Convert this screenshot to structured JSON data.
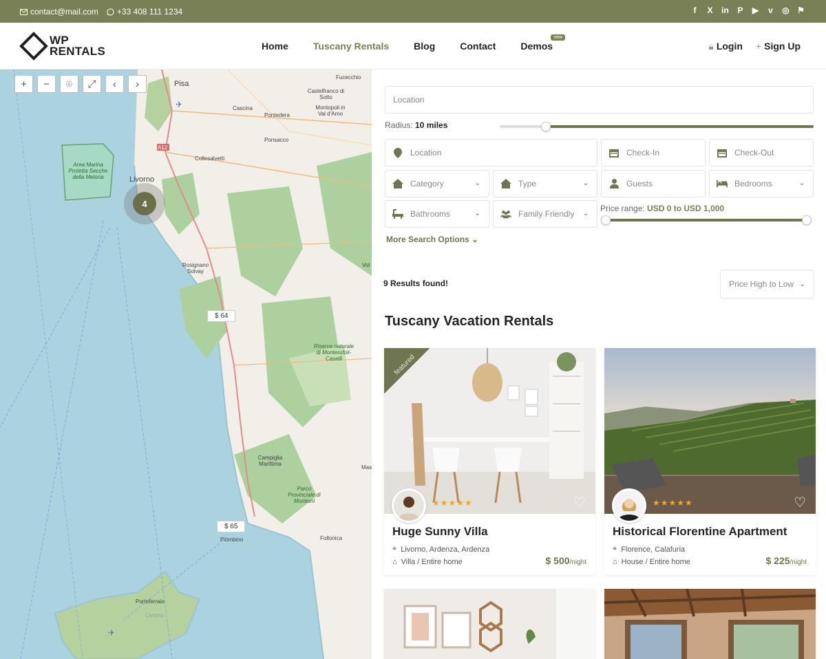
{
  "topbar": {
    "email": "contact@mail.com",
    "phone": "+33 408 111 1234",
    "social": [
      "facebook-icon",
      "x-icon",
      "linkedin-icon",
      "pinterest-icon",
      "youtube-icon",
      "vimeo-icon",
      "instagram-icon",
      "foursquare-icon"
    ]
  },
  "header": {
    "logo_line1": "WP",
    "logo_line2": "RENTALS",
    "nav": [
      "Home",
      "Tuscany Rentals",
      "Blog",
      "Contact",
      "Demos"
    ],
    "demos_badge": "new",
    "login": "Login",
    "signup": "Sign Up"
  },
  "map": {
    "cluster_count": "4",
    "price_pins": [
      "$ 64",
      "$ 65"
    ],
    "labels": {
      "pisa": "Pisa",
      "livorno": "Livorno",
      "cascina": "Cascina",
      "pontedera": "Pontedera",
      "collesalvetti": "Collesalvetti",
      "ponsacco": "Ponsacco",
      "rosignano": "Rosignano Solvay",
      "campiglia": "Campiglia Marittima",
      "piombino": "Piombino",
      "follonica": "Follonica",
      "portoferraio": "Portoferraio",
      "fucecchio": "Fucecchio",
      "castelfranco": "Castelfranco di Sotto",
      "montopoli": "Montopoli in Val d'Arno",
      "area_marina": "Area Marina Protetta Secche della Meloria",
      "riserva": "Riserva naturale di Monterufoli-Caselli",
      "parco": "Parco Provinciale di Montioni",
      "road_a12": "A12",
      "livorno_small": "Livorno",
      "mas": "Mas",
      "vol": "Vol"
    }
  },
  "search": {
    "location_placeholder": "Location",
    "radius_label": "Radius:",
    "radius_value": "10 miles",
    "location2_placeholder": "Location",
    "checkin": "Check-In",
    "checkout": "Check-Out",
    "category": "Category",
    "type": "Type",
    "guests": "Guests",
    "bedrooms": "Bedrooms",
    "bathrooms": "Bathrooms",
    "family": "Family Friendly",
    "price_label": "Price range:",
    "price_value": "USD 0 to USD 1,000",
    "more": "More Search Options"
  },
  "results": {
    "count_text": "9 Results found!",
    "sort": "Price High to Low",
    "section_title": "Tuscany Vacation Rentals"
  },
  "listings": [
    {
      "title": "Huge Sunny Villa",
      "location": "Livorno, Ardenza, Ardenza",
      "type": "Villa / Entire home",
      "price": "$ 500",
      "per": "/night",
      "featured": "featured",
      "rating": 5
    },
    {
      "title": "Historical Florentine Apartment",
      "location": "Florence, Calafuria",
      "type": "House / Entire home",
      "price": "$ 225",
      "per": "/night",
      "rating": 5
    }
  ],
  "colors": {
    "accent": "#7a8055",
    "price": "#6f7550",
    "star": "#f5a623"
  }
}
